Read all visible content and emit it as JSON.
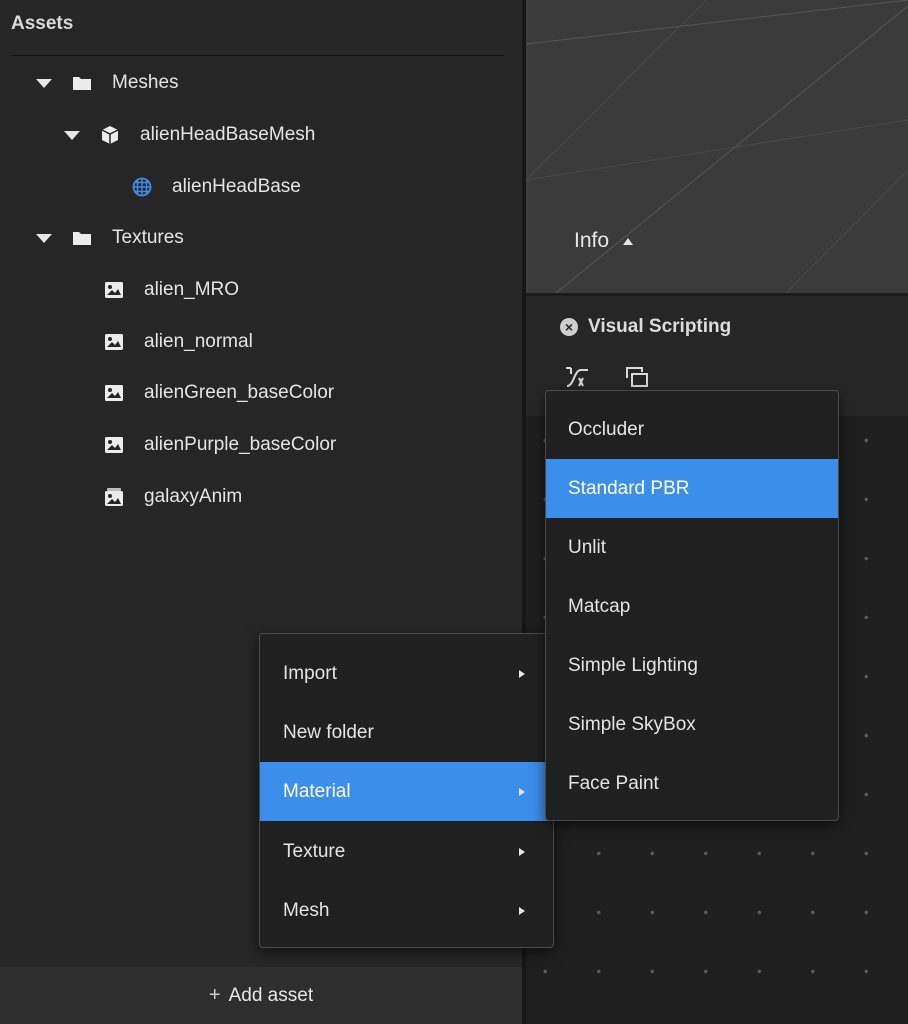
{
  "assets_panel": {
    "title": "Assets",
    "tree": [
      {
        "label": "Meshes",
        "icon": "folder-icon",
        "expanded": true
      },
      {
        "label": "alienHeadBaseMesh",
        "icon": "mesh-cube-icon",
        "expanded": true
      },
      {
        "label": "alienHeadBase",
        "icon": "mesh-geometry-icon",
        "icon_color": "#3b8ee9"
      },
      {
        "label": "Textures",
        "icon": "folder-icon",
        "expanded": true
      },
      {
        "label": "alien_MRO",
        "icon": "image-icon"
      },
      {
        "label": "alien_normal",
        "icon": "image-icon"
      },
      {
        "label": "alienGreen_baseColor",
        "icon": "image-icon"
      },
      {
        "label": "alienPurple_baseColor",
        "icon": "image-icon"
      },
      {
        "label": "galaxyAnim",
        "icon": "animated-texture-icon"
      }
    ],
    "add_asset": {
      "icon": "plus-icon",
      "label": "Add asset"
    }
  },
  "viewport": {
    "info_label": "Info"
  },
  "visual_scripting": {
    "title": "Visual Scripting",
    "close_icon": "close-circle-icon",
    "tools": [
      "node-tool-icon",
      "frame-tool-icon"
    ]
  },
  "context_menu": {
    "items": [
      {
        "label": "Import",
        "has_submenu": true
      },
      {
        "label": "New folder",
        "has_submenu": false
      },
      {
        "label": "Material",
        "has_submenu": true,
        "active": true
      },
      {
        "label": "Texture",
        "has_submenu": true
      },
      {
        "label": "Mesh",
        "has_submenu": true
      }
    ]
  },
  "material_submenu": {
    "items": [
      {
        "label": "Occluder"
      },
      {
        "label": "Standard PBR",
        "active": true
      },
      {
        "label": "Unlit"
      },
      {
        "label": "Matcap"
      },
      {
        "label": "Simple Lighting"
      },
      {
        "label": "Simple SkyBox"
      },
      {
        "label": "Face Paint"
      }
    ]
  },
  "colors": {
    "accent": "#3b8ee9",
    "panel_bg": "#262626",
    "menu_bg": "#202020"
  }
}
